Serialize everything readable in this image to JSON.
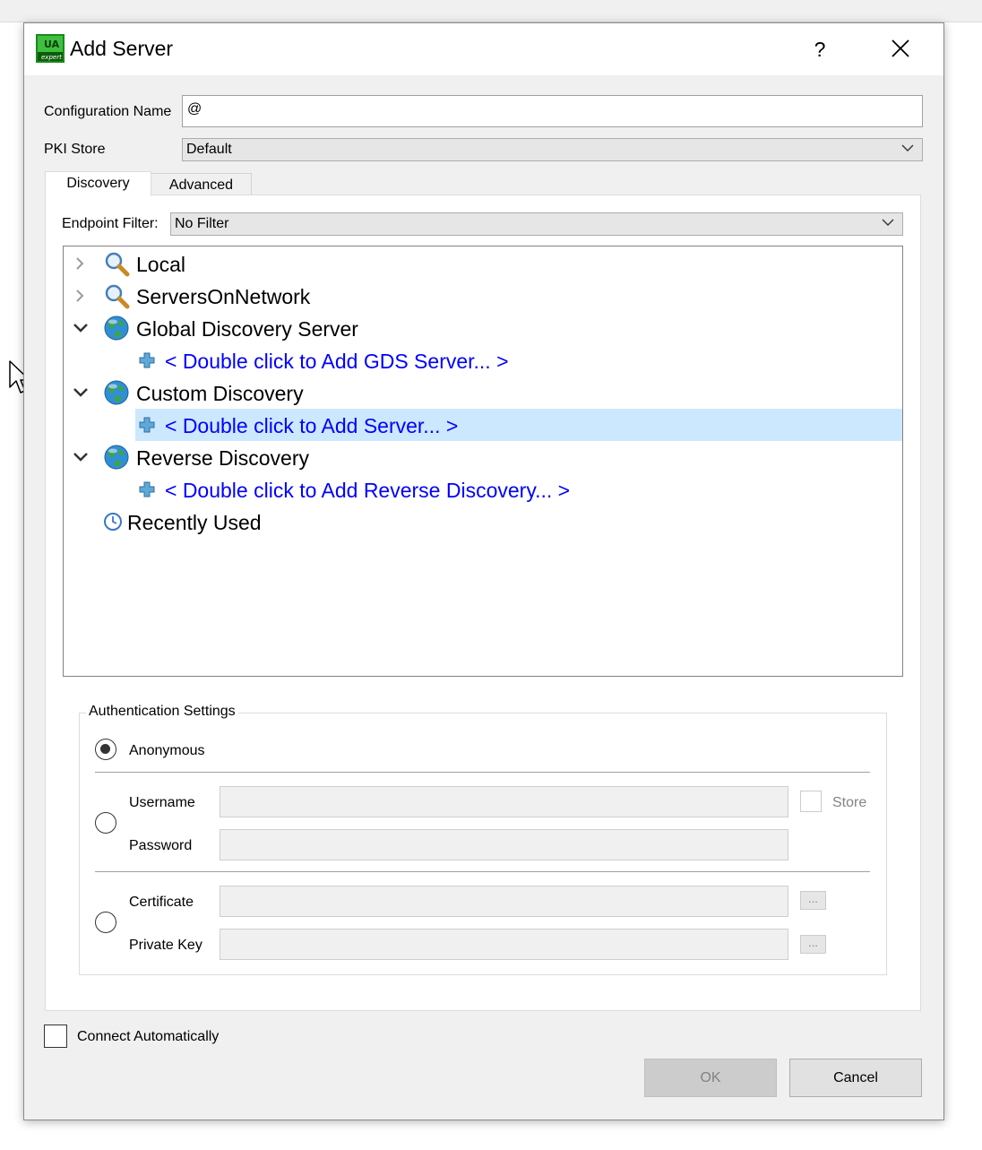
{
  "window": {
    "title": "Add Server",
    "help_label": "?",
    "icon": "uaexpert-app-icon"
  },
  "form": {
    "config_name_label": "Configuration Name",
    "config_name_value": "@",
    "pki_label": "PKI Store",
    "pki_value": "Default"
  },
  "tabs": [
    {
      "label": "Discovery",
      "active": true
    },
    {
      "label": "Advanced",
      "active": false
    }
  ],
  "discovery": {
    "endpoint_filter_label": "Endpoint Filter:",
    "endpoint_filter_value": "No Filter",
    "tree": {
      "local": {
        "label": "Local",
        "icon": "magnifier-icon",
        "expanded": false
      },
      "servers_on_network": {
        "label": "ServersOnNetwork",
        "icon": "magnifier-icon",
        "expanded": false
      },
      "gds": {
        "label": "Global Discovery Server",
        "icon": "globe-icon",
        "expanded": true,
        "child": "< Double click to Add GDS Server... >"
      },
      "custom": {
        "label": "Custom Discovery",
        "icon": "globe-icon",
        "expanded": true,
        "child": "< Double click to Add Server... >",
        "child_selected": true
      },
      "reverse": {
        "label": "Reverse Discovery",
        "icon": "globe-icon",
        "expanded": true,
        "child": "< Double click to Add Reverse Discovery... >"
      },
      "recent": {
        "label": "Recently Used",
        "icon": "clock-icon"
      }
    }
  },
  "auth": {
    "title": "Authentication Settings",
    "anonymous_label": "Anonymous",
    "selected": "anonymous",
    "username_label": "Username",
    "password_label": "Password",
    "store_label": "Store",
    "certificate_label": "Certificate",
    "private_key_label": "Private Key",
    "browse_label": "..."
  },
  "footer": {
    "connect_auto_label": "Connect Automatically",
    "connect_auto_checked": false,
    "ok_label": "OK",
    "cancel_label": "Cancel"
  },
  "colors": {
    "link_blue": "#0000ff",
    "selection": "#cce8ff",
    "dialog_bg": "#f0f0f0"
  }
}
